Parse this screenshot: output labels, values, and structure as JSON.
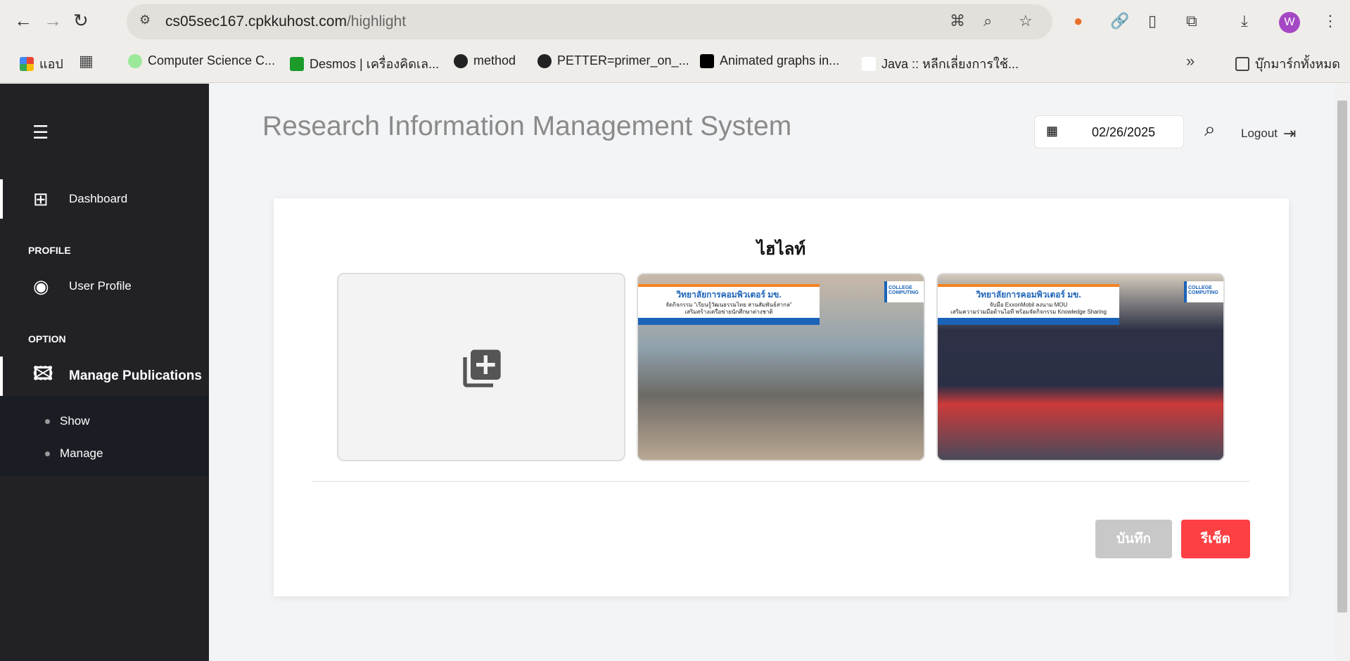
{
  "browser": {
    "url_host": "cs05sec167.cpkkuhost.com",
    "url_path": "/highlight",
    "profile_initial": "W",
    "bookmarks": [
      {
        "label": "แอป",
        "icon": "apps-icon"
      },
      {
        "label": "Computer Science C...",
        "icon": "cs-icon"
      },
      {
        "label": "Desmos | เครื่องคิดเล...",
        "icon": "desmos-icon"
      },
      {
        "label": "method",
        "icon": "globe-icon"
      },
      {
        "label": "PETTER=primer_on_...",
        "icon": "globe-icon"
      },
      {
        "label": "Animated graphs in...",
        "icon": "medium-icon"
      },
      {
        "label": "Java :: หลีกเลี่ยงการใช้...",
        "icon": "cc-icon"
      }
    ],
    "all_bookmarks": "บุ๊กมาร์กทั้งหมด"
  },
  "sidebar": {
    "dashboard": "Dashboard",
    "profile_heading": "PROFILE",
    "user_profile": "User Profile",
    "option_heading": "OPTION",
    "manage_publications": "Manage Publications",
    "sub_items": [
      "Show",
      "Manage"
    ]
  },
  "header": {
    "title": "Research Information Management System",
    "date": "02/26/2025",
    "logout": "Logout"
  },
  "main": {
    "heading": "ไฮไลท์",
    "photos": [
      {
        "headline": "วิทยาลัยการคอมพิวเตอร์ มข.",
        "line1": "จัดกิจกรรม \"เรียนรู้วัฒนธรรมไทย สานสัมพันธ์สากล\"",
        "line2": "เสริมสร้างเครือข่ายนักศึกษาต่างชาติ",
        "logo": "COLLEGE COMPUTING"
      },
      {
        "headline": "วิทยาลัยการคอมพิวเตอร์ มข.",
        "line1": "จับมือ ExxonMobil ลงนาม MOU",
        "line2": "เสริมความร่วมมือด้านไอที พร้อมจัดกิจกรรม Knowledge Sharing",
        "logo": "COLLEGE COMPUTING"
      }
    ],
    "save": "บันทึก",
    "reset": "รีเซ็ต"
  },
  "colors": {
    "sidebar": "#222126",
    "reset": "#fd4044",
    "save": "#c8c8c8"
  }
}
